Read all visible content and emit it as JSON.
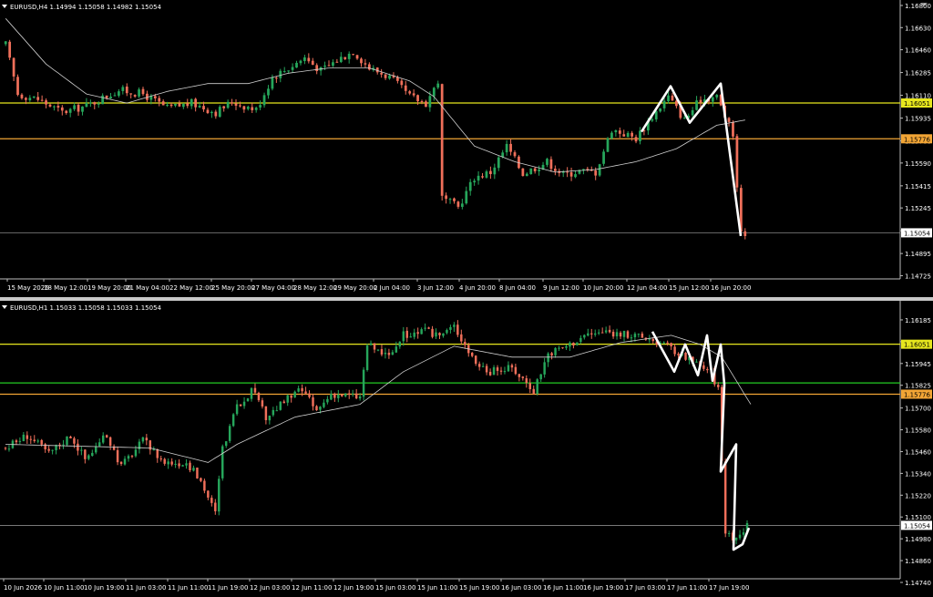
{
  "colors": {
    "bull": "#26a65b",
    "bear": "#ef6f5a",
    "ma": "#cfcfcf",
    "yellow": "#e6e61e",
    "orange": "#f2a535",
    "green": "#22cc22",
    "grey": "#a0a0a0",
    "bg": "#000000",
    "text": "#ffffff"
  },
  "chart_data": [
    {
      "type": "candlestick",
      "title": "EURUSD,H4  1.14994 1.15058 1.14982 1.15054",
      "ylim": [
        1.147,
        1.168
      ],
      "y_ticks": [
        "1.16800",
        "1.16630",
        "1.16460",
        "1.16285",
        "1.16110",
        "1.15935",
        "1.15760",
        "1.15590",
        "1.15415",
        "1.15245",
        "1.15070",
        "1.14895",
        "1.14725"
      ],
      "x_ticks": [
        "15 May 2026",
        "18 May 12:00",
        "19 May 20:00",
        "21 May 04:00",
        "22 May 12:00",
        "25 May 20:00",
        "27 May 04:00",
        "28 May 12:00",
        "29 May 20:00",
        "2 Jun 04:00",
        "3 Jun 12:00",
        "4 Jun 20:00",
        "8 Jun 04:00",
        "9 Jun 12:00",
        "10 Jun 20:00",
        "12 Jun 04:00",
        "15 Jun 12:00",
        "16 Jun 20:00"
      ],
      "levels": [
        {
          "price": 1.16051,
          "label": "1.16051",
          "color": "yellow"
        },
        {
          "price": 1.15776,
          "label": "1.15776",
          "color": "orange"
        },
        {
          "price": 1.15054,
          "label": "1.15054",
          "color": "grey"
        }
      ],
      "waypoints": [
        [
          0,
          1.165
        ],
        [
          3,
          1.1612
        ],
        [
          8,
          1.1608
        ],
        [
          14,
          1.1598
        ],
        [
          20,
          1.1603
        ],
        [
          28,
          1.1615
        ],
        [
          34,
          1.1612
        ],
        [
          40,
          1.1601
        ],
        [
          46,
          1.1605
        ],
        [
          52,
          1.1598
        ],
        [
          56,
          1.1606
        ],
        [
          62,
          1.16
        ],
        [
          66,
          1.1625
        ],
        [
          70,
          1.1632
        ],
        [
          74,
          1.164
        ],
        [
          78,
          1.163
        ],
        [
          82,
          1.1638
        ],
        [
          86,
          1.1645
        ],
        [
          90,
          1.1632
        ],
        [
          95,
          1.1625
        ],
        [
          100,
          1.161
        ],
        [
          104,
          1.1605
        ],
        [
          107,
          1.1622
        ],
        [
          108,
          1.1532
        ],
        [
          112,
          1.1525
        ],
        [
          116,
          1.1548
        ],
        [
          120,
          1.1552
        ],
        [
          124,
          1.1572
        ],
        [
          128,
          1.1551
        ],
        [
          134,
          1.156
        ],
        [
          138,
          1.155
        ],
        [
          142,
          1.1553
        ],
        [
          146,
          1.1552
        ],
        [
          150,
          1.1585
        ],
        [
          156,
          1.1578
        ],
        [
          160,
          1.1595
        ],
        [
          164,
          1.161
        ],
        [
          168,
          1.1592
        ],
        [
          172,
          1.1608
        ],
        [
          176,
          1.161
        ],
        [
          178,
          1.1595
        ],
        [
          180,
          1.158
        ],
        [
          182,
          1.1504
        ],
        [
          183,
          1.1506
        ]
      ],
      "ma_waypoints": [
        [
          0,
          1.167
        ],
        [
          10,
          1.1635
        ],
        [
          20,
          1.1612
        ],
        [
          30,
          1.1605
        ],
        [
          40,
          1.1614
        ],
        [
          50,
          1.162
        ],
        [
          60,
          1.162
        ],
        [
          70,
          1.1628
        ],
        [
          80,
          1.1632
        ],
        [
          90,
          1.1632
        ],
        [
          100,
          1.1622
        ],
        [
          106,
          1.161
        ],
        [
          116,
          1.1572
        ],
        [
          126,
          1.156
        ],
        [
          136,
          1.1552
        ],
        [
          146,
          1.1554
        ],
        [
          156,
          1.156
        ],
        [
          166,
          1.157
        ],
        [
          176,
          1.1588
        ],
        [
          183,
          1.1592
        ]
      ],
      "hand_path": [
        [
          1.1583,
          0
        ],
        [
          1.1618,
          0
        ],
        [
          1.159,
          0
        ],
        [
          1.162,
          0
        ],
        [
          1.1503,
          0
        ]
      ],
      "hand_x": [
        704,
        736,
        757,
        791,
        813
      ]
    },
    {
      "type": "candlestick",
      "title": "EURUSD,H1  1.15033 1.15058 1.15033 1.15054",
      "ylim": [
        1.1476,
        1.1626
      ],
      "y_ticks": [
        "1.16185",
        "1.16065",
        "1.15945",
        "1.15825",
        "1.15700",
        "1.15580",
        "1.15460",
        "1.15340",
        "1.15220",
        "1.15100",
        "1.14980",
        "1.14860",
        "1.14740"
      ],
      "x_ticks": [
        "10 Jun 2026",
        "10 Jun 11:00",
        "10 Jun 19:00",
        "11 Jun 03:00",
        "11 Jun 11:00",
        "11 Jun 19:00",
        "12 Jun 03:00",
        "12 Jun 11:00",
        "12 Jun 19:00",
        "15 Jun 03:00",
        "15 Jun 11:00",
        "15 Jun 19:00",
        "16 Jun 03:00",
        "16 Jun 11:00",
        "16 Jun 19:00",
        "17 Jun 03:00",
        "17 Jun 11:00",
        "17 Jun 19:00"
      ],
      "levels": [
        {
          "price": 1.15838,
          "label": "",
          "color": "green"
        },
        {
          "price": 1.16051,
          "label": "1.16051",
          "color": "yellow"
        },
        {
          "price": 1.15776,
          "label": "1.15776",
          "color": "orange"
        },
        {
          "price": 1.15054,
          "label": "1.15054",
          "color": "grey"
        }
      ],
      "waypoints": [
        [
          0,
          1.1548
        ],
        [
          6,
          1.1555
        ],
        [
          12,
          1.1545
        ],
        [
          18,
          1.1555
        ],
        [
          22,
          1.1542
        ],
        [
          28,
          1.1555
        ],
        [
          32,
          1.1538
        ],
        [
          38,
          1.1552
        ],
        [
          44,
          1.154
        ],
        [
          50,
          1.154
        ],
        [
          54,
          1.153
        ],
        [
          58,
          1.1512
        ],
        [
          60,
          1.1548
        ],
        [
          64,
          1.157
        ],
        [
          68,
          1.158
        ],
        [
          72,
          1.1565
        ],
        [
          78,
          1.1575
        ],
        [
          82,
          1.158
        ],
        [
          86,
          1.1568
        ],
        [
          90,
          1.1578
        ],
        [
          98,
          1.1576
        ],
        [
          100,
          1.1605
        ],
        [
          106,
          1.1598
        ],
        [
          110,
          1.161
        ],
        [
          116,
          1.1612
        ],
        [
          120,
          1.161
        ],
        [
          124,
          1.1615
        ],
        [
          130,
          1.1595
        ],
        [
          134,
          1.159
        ],
        [
          140,
          1.1592
        ],
        [
          146,
          1.158
        ],
        [
          150,
          1.16
        ],
        [
          156,
          1.1605
        ],
        [
          160,
          1.161
        ],
        [
          166,
          1.1612
        ],
        [
          172,
          1.161
        ],
        [
          178,
          1.1608
        ],
        [
          182,
          1.1605
        ],
        [
          186,
          1.16
        ],
        [
          190,
          1.1595
        ],
        [
          195,
          1.159
        ],
        [
          197,
          1.158
        ],
        [
          199,
          1.1502
        ],
        [
          202,
          1.1498
        ],
        [
          204,
          1.1503
        ],
        [
          205,
          1.1505
        ]
      ],
      "ma_waypoints": [
        [
          0,
          1.155
        ],
        [
          20,
          1.1549
        ],
        [
          40,
          1.1548
        ],
        [
          56,
          1.154
        ],
        [
          64,
          1.155
        ],
        [
          80,
          1.1565
        ],
        [
          98,
          1.1572
        ],
        [
          110,
          1.159
        ],
        [
          124,
          1.1604
        ],
        [
          140,
          1.1598
        ],
        [
          156,
          1.1598
        ],
        [
          170,
          1.1606
        ],
        [
          184,
          1.161
        ],
        [
          192,
          1.1605
        ],
        [
          198,
          1.1598
        ],
        [
          206,
          1.1572
        ]
      ],
      "hand_path": [
        [
          1.1612,
          0
        ],
        [
          1.159,
          0
        ],
        [
          1.1605,
          0
        ],
        [
          1.1588,
          0
        ],
        [
          1.161,
          0
        ],
        [
          1.1585,
          0
        ],
        [
          1.1605,
          0
        ],
        [
          1.1583,
          0
        ],
        [
          1.1535,
          0
        ],
        [
          1.155,
          0
        ],
        [
          1.1492,
          0
        ],
        [
          1.1495,
          0
        ],
        [
          1.1504,
          0
        ]
      ],
      "hand_x": [
        716,
        740,
        752,
        766,
        776,
        782,
        791,
        795,
        791,
        808,
        805,
        815,
        822
      ]
    }
  ]
}
